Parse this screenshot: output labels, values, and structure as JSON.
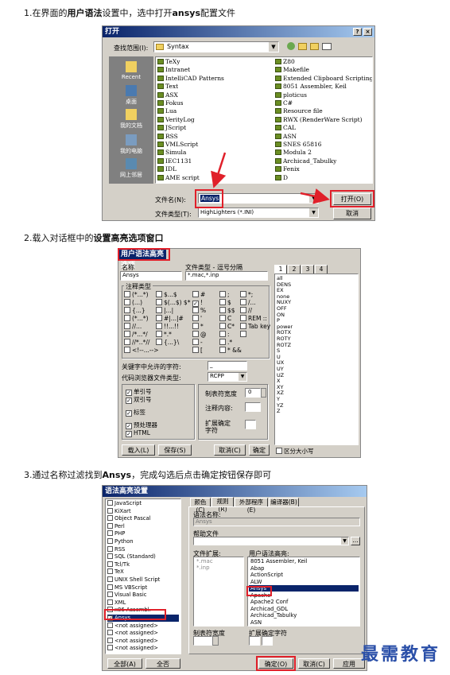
{
  "steps": [
    {
      "pre": "1.在界面的",
      "b1": "用户语法",
      "mid": "设置中，选中打开",
      "b2": "ansys",
      "post": "配置文件"
    },
    {
      "pre": "2.载入对话框中的",
      "b1": "设置高亮选项窗口"
    },
    {
      "pre": "3.通过名称过滤找到",
      "b1": "Ansys",
      "post": "，完成勾选后点击确定按钮保存即可"
    }
  ],
  "open_dialog": {
    "title": "打开",
    "lookin_label": "查找范围(I):",
    "lookin_value": "Syntax",
    "places": [
      "Recent",
      "桌面",
      "我的文档",
      "我的电脑",
      "网上邻居"
    ],
    "files_col1": [
      "TeXy",
      "Intranet",
      "IntelliCAD Patterns",
      "Text",
      "ASX",
      "Fokus",
      "Lua",
      "VerityLog",
      "JScript",
      "RSS",
      "VMLScript",
      "Simula",
      "IEC1131",
      "IDL",
      "AME script"
    ],
    "files_col2": [
      "Z80",
      "Makefile",
      "Extended Clipboard Scripting L",
      "8051 Assembler, Keil",
      "ploticus",
      "C#",
      "Resource file",
      "RWX (RenderWare Script)",
      "CAL",
      "ASN",
      "SNES 65816",
      "Modula 2",
      "Archicad_Tabulky",
      "Fenix",
      "D"
    ],
    "filename_label": "文件名(N):",
    "filename_value": "Ansys",
    "filetype_label": "文件类型(T):",
    "filetype_value": "HighLighters (*.INI)",
    "open_btn": "打开(O)",
    "cancel_btn": "取消"
  },
  "hl_dialog": {
    "title": "用户语法高亮选项",
    "name_label": "名称",
    "name_value": "Ansys",
    "ftype_label": "文件类型 - 逗号分隔",
    "ftype_value": "*.mac,*.inp",
    "tabs": [
      "1",
      "2",
      "3",
      "4"
    ],
    "comment_group": "注释类型",
    "comment_cols": [
      [
        "(*...*)",
        "(...)",
        "{...}",
        "(*...*)",
        "//...",
        "/*...*/",
        "//*..*//",
        "<!--...-->"
      ],
      [
        "$...$",
        "$(...$) $*",
        "|...|",
        "#|...|#",
        "!!...!!",
        "*.*",
        "{...}\\",
        ""
      ],
      [
        "#",
        "!",
        "%",
        "'",
        "*",
        "@",
        "-",
        "["
      ],
      [
        ";",
        "$",
        "$$",
        "C",
        "C*",
        ":",
        ".*",
        "* &&"
      ],
      [
        "*;",
        "/...",
        "//",
        "REM ::",
        "Tab key",
        "",
        "",
        ""
      ]
    ],
    "comment_checked": "!",
    "keywords": [
      "all",
      "DENS",
      "EX",
      "none",
      "NUXY",
      "OFF",
      "ON",
      "P",
      "power",
      "ROTX",
      "ROTY",
      "ROTZ",
      "S",
      "U",
      "UX",
      "UY",
      "UZ",
      "X",
      "XY",
      "XZ",
      "Y",
      "YZ",
      "Z"
    ],
    "keychar_label": "关键字中允许的字符:",
    "keychar_value": "_",
    "codebrowse_label": "代码浏览器文件类型:",
    "codebrowse_value": "RCPP",
    "opts": [
      "单引号",
      "双引号",
      "标签",
      "预处理器",
      "HTML"
    ],
    "tabwidth_label": "制表符宽度",
    "tabwidth_value": "0",
    "comment_content_label": "注释内容:",
    "ext_label": "扩展确定字符",
    "load_btn": "载入(L)",
    "save_btn": "保存(S)",
    "cancel_btn": "取消(C)",
    "ok_btn": "确定",
    "case_label": "区分大小写"
  },
  "syntax_dialog": {
    "title": "语法高亮设置",
    "list": [
      "JavaScript",
      "KiXart",
      "Object Pascal",
      "Perl",
      "PHP",
      "Python",
      "RSS",
      "SQL (Standard)",
      "Tcl/Tk",
      "TeX",
      "UNIX Shell Script",
      "MS VBScript",
      "Visual Basic",
      "XML",
      "x86 Assembl.",
      "Ansys",
      "<not assigned>",
      "<not assigned>",
      "<not assigned>",
      "<not assigned>"
    ],
    "checked": "Ansys",
    "tabs": [
      "颜色(C)",
      "规则(R)",
      "外部程序(E)",
      "编译器(B)"
    ],
    "name_label": "语法名称:",
    "name_value": "Ansys",
    "help_label": "帮助文件",
    "ext_label": "文件扩展:",
    "exts": [
      "*.mac",
      "*.inp"
    ],
    "userdef_label": "用户语法高亮:",
    "userdef": [
      "8051 Assembler, Keil",
      "Abap",
      "ActionScript",
      "ALW",
      "Ansys",
      "Apache",
      "Apache2 Conf",
      "Archicad_GDL",
      "Archicad_Tabulky",
      "ASN"
    ],
    "selected": "Ansys",
    "tabwidth_label": "制表符宽度",
    "extchar_label": "扩展确定字符",
    "all_on": "全部(A)",
    "all_off": "全否",
    "ok_btn": "确定(O)",
    "cancel_btn": "取消(C)",
    "apply_btn": "应用"
  },
  "watermark": "最需教育",
  "colors": {
    "accent": "#e0202a",
    "title": "#0a246a",
    "face": "#d4d0c8"
  }
}
